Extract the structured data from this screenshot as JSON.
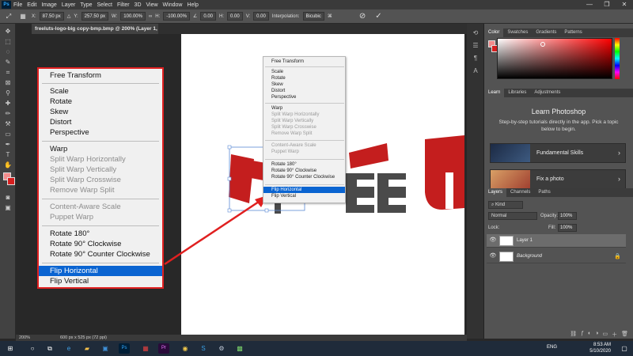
{
  "app": {
    "logo": "Ps",
    "menus": [
      "File",
      "Edit",
      "Image",
      "Layer",
      "Type",
      "Select",
      "Filter",
      "3D",
      "View",
      "Window",
      "Help"
    ],
    "window_controls": [
      "—",
      "❐",
      "✕"
    ]
  },
  "options_bar": {
    "x_label": "X:",
    "x_value": "87.50 px",
    "y_label": "Y:",
    "y_value": "257.50 px",
    "w_label": "W:",
    "w_value": "100.00%",
    "h_label": "H:",
    "h_value": "-100.00%",
    "angle_value": "0.00",
    "h_skew": "0.00",
    "v_skew": "0.00",
    "interp_label": "Interpolation:",
    "interp_value": "Bicubic",
    "cancel_icon": "⊘",
    "commit_icon": "✓"
  },
  "document": {
    "tab_title": "freeluts-logo-big copy-bmp.bmp @ 200% (Layer 1, RGB/8) *"
  },
  "context_menu": {
    "items": [
      {
        "label": "Free Transform",
        "state": "enabled"
      },
      {
        "label": "Scale",
        "state": "enabled"
      },
      {
        "label": "Rotate",
        "state": "enabled"
      },
      {
        "label": "Skew",
        "state": "enabled"
      },
      {
        "label": "Distort",
        "state": "enabled"
      },
      {
        "label": "Perspective",
        "state": "enabled"
      },
      {
        "label": "Warp",
        "state": "enabled"
      },
      {
        "label": "Split Warp Horizontally",
        "state": "disabled"
      },
      {
        "label": "Split Warp Vertically",
        "state": "disabled"
      },
      {
        "label": "Split Warp Crosswise",
        "state": "disabled"
      },
      {
        "label": "Remove Warp Split",
        "state": "disabled"
      },
      {
        "label": "Content-Aware Scale",
        "state": "disabled"
      },
      {
        "label": "Puppet Warp",
        "state": "disabled"
      },
      {
        "label": "Rotate 180°",
        "state": "enabled"
      },
      {
        "label": "Rotate 90° Clockwise",
        "state": "enabled"
      },
      {
        "label": "Rotate 90° Counter Clockwise",
        "state": "enabled"
      },
      {
        "label": "Flip Horizontal",
        "state": "selected"
      },
      {
        "label": "Flip Vertical",
        "state": "enabled"
      }
    ]
  },
  "right_panel": {
    "color_tabs": [
      "Color",
      "Swatches",
      "Gradients",
      "Patterns"
    ],
    "learn_tabs": [
      "Learn",
      "Libraries",
      "Adjustments"
    ],
    "learn_title": "Learn Photoshop",
    "learn_desc": "Step-by-step tutorials directly in the app. Pick a topic below to begin.",
    "cards": [
      {
        "label": "Fundamental Skills"
      },
      {
        "label": "Fix a photo"
      }
    ],
    "layers_tabs": [
      "Layers",
      "Channels",
      "Paths"
    ],
    "kind_label": "Kind",
    "blend_mode": "Normal",
    "opacity_label": "Opacity:",
    "opacity_value": "100%",
    "lock_label": "Lock:",
    "fill_label": "Fill:",
    "fill_value": "100%",
    "layers": [
      {
        "name": "Layer 1",
        "selected": true
      },
      {
        "name": "Background",
        "selected": false
      }
    ]
  },
  "status_bar": {
    "zoom": "200%",
    "doc_info": "600 px x 525 px (72 ppi)"
  },
  "taskbar": {
    "lang": "ENG",
    "time": "8:53 AM",
    "date": "5/10/2020"
  },
  "colors": {
    "accent": "#0a64d1",
    "brand_red": "#c41e1e",
    "highlight_border": "#e02020",
    "foreground": "#f28b8b",
    "background": "#d51f1f"
  }
}
